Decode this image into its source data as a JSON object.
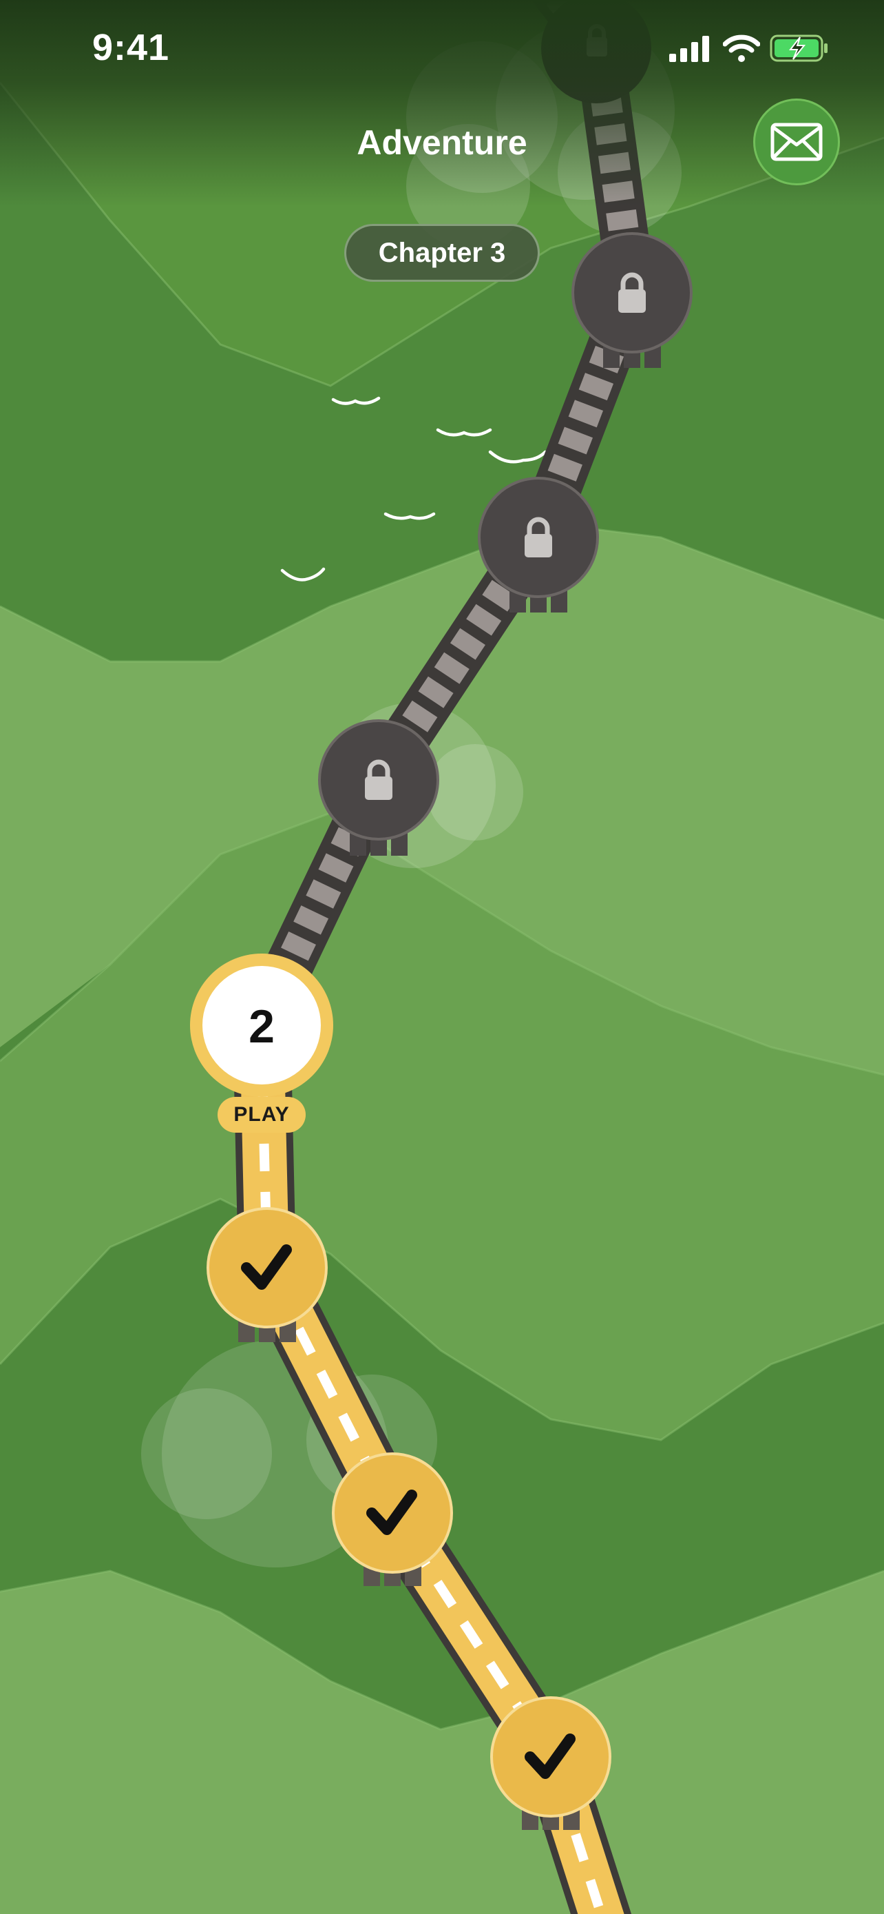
{
  "status_bar": {
    "time": "9:41",
    "icons": [
      "cellular-signal-icon",
      "wifi-icon",
      "battery-charging-icon"
    ]
  },
  "header": {
    "title": "Adventure",
    "mail_icon": "envelope-icon"
  },
  "chapter": {
    "label": "Chapter 3"
  },
  "levels": [
    {
      "state": "locked",
      "icon": "lock-icon"
    },
    {
      "state": "locked",
      "icon": "lock-icon"
    },
    {
      "state": "locked",
      "icon": "lock-icon"
    },
    {
      "state": "locked",
      "icon": "lock-icon"
    },
    {
      "state": "current",
      "number": "2",
      "action_label": "PLAY"
    },
    {
      "state": "completed",
      "icon": "checkmark-icon"
    },
    {
      "state": "completed",
      "icon": "checkmark-icon"
    },
    {
      "state": "completed",
      "icon": "checkmark-icon"
    }
  ],
  "colors": {
    "grass_dark": "#4f8a3c",
    "grass_light": "#79ad5e",
    "locked_node": "#4a4646",
    "completed_node": "#eab94a",
    "current_ring": "#f3c95e",
    "path_done": "#f2c55a"
  }
}
